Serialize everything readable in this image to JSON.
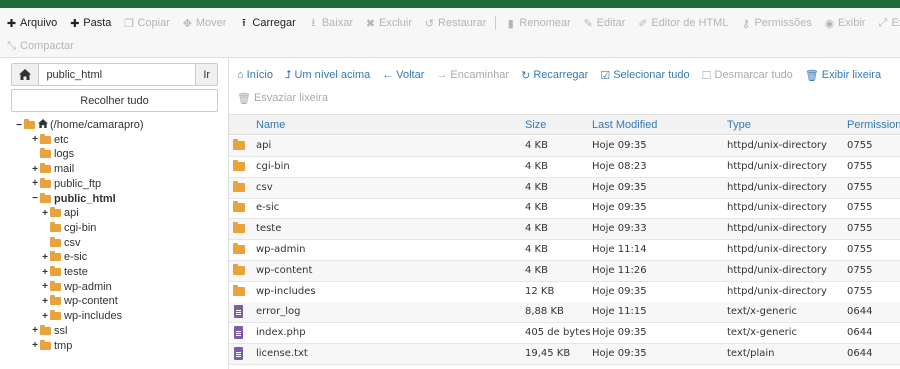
{
  "toolbar": {
    "row1": [
      {
        "icon": "plus-icon",
        "glyph": "✚",
        "label": "Arquivo",
        "enabled": true
      },
      {
        "icon": "plus-icon",
        "glyph": "✚",
        "label": "Pasta",
        "enabled": true
      },
      {
        "icon": "copy-icon",
        "glyph": "❐",
        "label": "Copiar",
        "enabled": false
      },
      {
        "icon": "move-icon",
        "glyph": "✥",
        "label": "Mover",
        "enabled": false
      },
      {
        "icon": "upload-icon",
        "glyph": "⭱",
        "label": "Carregar",
        "enabled": true
      },
      {
        "icon": "download-icon",
        "glyph": "⭳",
        "label": "Baixar",
        "enabled": false
      },
      {
        "icon": "delete-icon",
        "glyph": "✖",
        "label": "Excluir",
        "enabled": false
      },
      {
        "icon": "restore-icon",
        "glyph": "↺",
        "label": "Restaurar",
        "enabled": false
      },
      {
        "icon": "rename-icon",
        "glyph": "▮",
        "label": "Renomear",
        "enabled": false
      },
      {
        "icon": "edit-icon",
        "glyph": "✎",
        "label": "Editar",
        "enabled": false
      },
      {
        "icon": "html-editor-icon",
        "glyph": "✐",
        "label": "Editor de HTML",
        "enabled": false
      },
      {
        "icon": "key-icon",
        "glyph": "⚷",
        "label": "Permissões",
        "enabled": false
      },
      {
        "icon": "eye-icon",
        "glyph": "◉",
        "label": "Exibir",
        "enabled": false
      },
      {
        "icon": "extract-icon",
        "glyph": "⤢",
        "label": "Extrair",
        "enabled": false
      }
    ],
    "row2": [
      {
        "icon": "compress-icon",
        "glyph": "⤡",
        "label": "Compactar",
        "enabled": false
      }
    ]
  },
  "left": {
    "path_value": "public_html",
    "go_label": "Ir",
    "collapse_label": "Recolher tudo",
    "tree": [
      {
        "toggle": "−",
        "label": "(/home/camarapro)",
        "home": true,
        "depth": 0,
        "bold": false
      },
      {
        "toggle": "+",
        "label": "etc",
        "depth": 1,
        "bold": false
      },
      {
        "toggle": "",
        "label": "logs",
        "depth": 1,
        "bold": false
      },
      {
        "toggle": "+",
        "label": "mail",
        "depth": 1,
        "bold": false
      },
      {
        "toggle": "+",
        "label": "public_ftp",
        "depth": 1,
        "bold": false
      },
      {
        "toggle": "−",
        "label": "public_html",
        "depth": 1,
        "bold": true
      },
      {
        "toggle": "+",
        "label": "api",
        "depth": 2,
        "bold": false
      },
      {
        "toggle": "",
        "label": "cgi-bin",
        "depth": 2,
        "bold": false
      },
      {
        "toggle": "",
        "label": "csv",
        "depth": 2,
        "bold": false
      },
      {
        "toggle": "+",
        "label": "e-sic",
        "depth": 2,
        "bold": false
      },
      {
        "toggle": "+",
        "label": "teste",
        "depth": 2,
        "bold": false
      },
      {
        "toggle": "+",
        "label": "wp-admin",
        "depth": 2,
        "bold": false
      },
      {
        "toggle": "+",
        "label": "wp-content",
        "depth": 2,
        "bold": false
      },
      {
        "toggle": "+",
        "label": "wp-includes",
        "depth": 2,
        "bold": false
      },
      {
        "toggle": "+",
        "label": "ssl",
        "depth": 1,
        "bold": false
      },
      {
        "toggle": "+",
        "label": "tmp",
        "depth": 1,
        "bold": false
      }
    ]
  },
  "actions": {
    "row1": [
      {
        "icon": "home-icon",
        "glyph": "⌂",
        "label": "Início",
        "enabled": true
      },
      {
        "icon": "level-up-icon",
        "glyph": "⮥",
        "label": "Um nível acima",
        "enabled": true
      },
      {
        "icon": "back-icon",
        "glyph": "←",
        "label": "Voltar",
        "enabled": true
      },
      {
        "icon": "forward-icon",
        "glyph": "→",
        "label": "Encaminhar",
        "enabled": false
      },
      {
        "icon": "reload-icon",
        "glyph": "↻",
        "label": "Recarregar",
        "enabled": true
      },
      {
        "icon": "check-square-icon",
        "glyph": "☑",
        "label": "Selecionar tudo",
        "enabled": true
      },
      {
        "icon": "square-icon",
        "glyph": "☐",
        "label": "Desmarcar tudo",
        "enabled": false
      },
      {
        "icon": "trash-icon",
        "glyph": "🗑",
        "label": "Exibir lixeira",
        "enabled": true
      }
    ],
    "row2": [
      {
        "icon": "trash-icon",
        "glyph": "🗑",
        "label": "Esvaziar lixeira",
        "enabled": false
      }
    ]
  },
  "table": {
    "headers": {
      "name": "Name",
      "size": "Size",
      "modified": "Last Modified",
      "type": "Type",
      "perms": "Permissions"
    },
    "rows": [
      {
        "kind": "folder",
        "name": "api",
        "size": "4 KB",
        "modified": "Hoje 09:35",
        "type": "httpd/unix-directory",
        "perms": "0755"
      },
      {
        "kind": "folder",
        "name": "cgi-bin",
        "size": "4 KB",
        "modified": "Hoje 08:23",
        "type": "httpd/unix-directory",
        "perms": "0755"
      },
      {
        "kind": "folder",
        "name": "csv",
        "size": "4 KB",
        "modified": "Hoje 09:35",
        "type": "httpd/unix-directory",
        "perms": "0755"
      },
      {
        "kind": "folder",
        "name": "e-sic",
        "size": "4 KB",
        "modified": "Hoje 09:35",
        "type": "httpd/unix-directory",
        "perms": "0755"
      },
      {
        "kind": "folder",
        "name": "teste",
        "size": "4 KB",
        "modified": "Hoje 09:33",
        "type": "httpd/unix-directory",
        "perms": "0755"
      },
      {
        "kind": "folder",
        "name": "wp-admin",
        "size": "4 KB",
        "modified": "Hoje 11:14",
        "type": "httpd/unix-directory",
        "perms": "0755"
      },
      {
        "kind": "folder",
        "name": "wp-content",
        "size": "4 KB",
        "modified": "Hoje 11:26",
        "type": "httpd/unix-directory",
        "perms": "0755"
      },
      {
        "kind": "folder",
        "name": "wp-includes",
        "size": "12 KB",
        "modified": "Hoje 09:35",
        "type": "httpd/unix-directory",
        "perms": "0755"
      },
      {
        "kind": "file",
        "name": "error_log",
        "size": "8,88 KB",
        "modified": "Hoje 11:15",
        "type": "text/x-generic",
        "perms": "0644"
      },
      {
        "kind": "file",
        "name": "index.php",
        "size": "405 de bytes",
        "modified": "Hoje 09:35",
        "type": "text/x-generic",
        "perms": "0644"
      },
      {
        "kind": "file",
        "name": "license.txt",
        "size": "19,45 KB",
        "modified": "Hoje 09:35",
        "type": "text/plain",
        "perms": "0644"
      }
    ]
  }
}
